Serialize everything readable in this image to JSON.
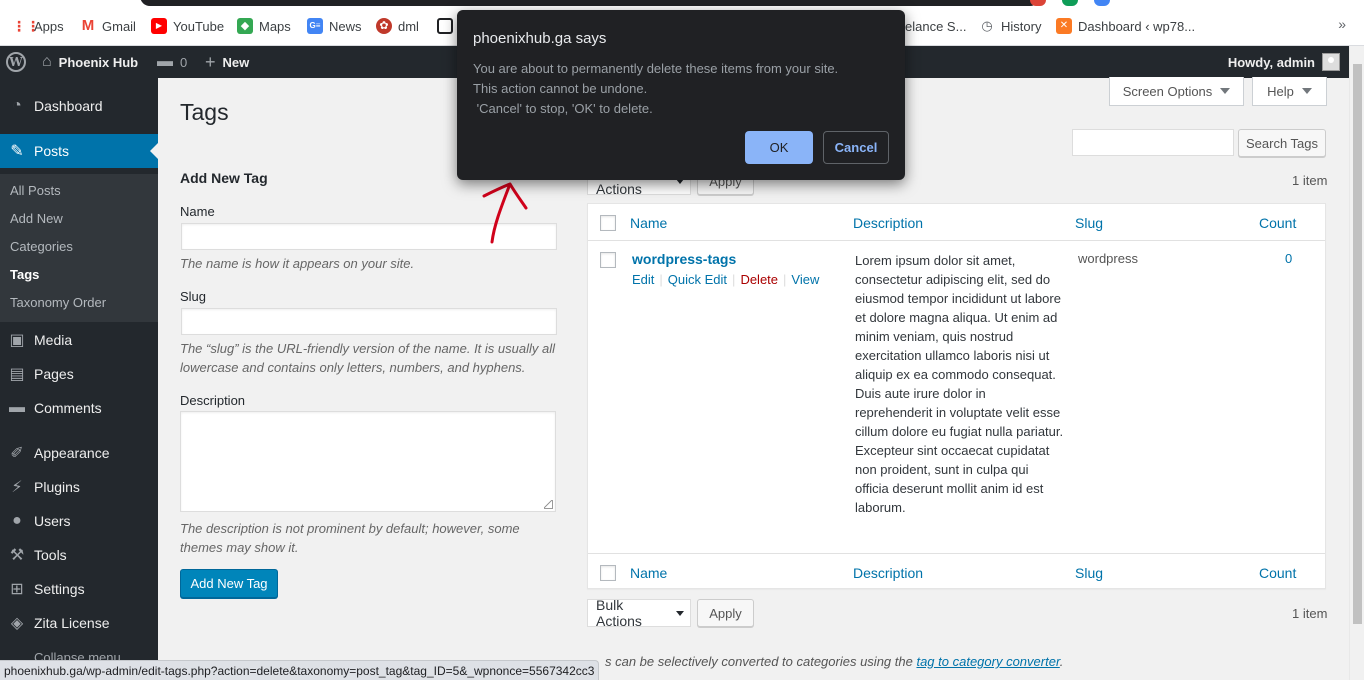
{
  "bookmarks": [
    {
      "label": "Apps",
      "icon": "apps-grid-icon"
    },
    {
      "label": "Gmail",
      "icon": "gmail-icon"
    },
    {
      "label": "YouTube",
      "icon": "youtube-icon"
    },
    {
      "label": "Maps",
      "icon": "maps-icon"
    },
    {
      "label": "News",
      "icon": "news-icon"
    },
    {
      "label": "dml",
      "icon": "dml-icon"
    },
    {
      "label": "elance S...",
      "icon": "bookmark-icon"
    },
    {
      "label": "History",
      "icon": "history-icon"
    },
    {
      "label": "Dashboard ‹ wp78...",
      "icon": "xampp-icon"
    }
  ],
  "adminbar": {
    "site_name": "Phoenix Hub",
    "comments_count": "0",
    "new_label": "New",
    "howdy": "Howdy, admin"
  },
  "sidebar": {
    "items": [
      {
        "label": "Dashboard",
        "icon": "dashboard-icon"
      },
      {
        "label": "Posts",
        "icon": "pin-icon",
        "active": true
      },
      {
        "label": "Media",
        "icon": "media-icon"
      },
      {
        "label": "Pages",
        "icon": "pages-icon"
      },
      {
        "label": "Comments",
        "icon": "comment-icon"
      },
      {
        "label": "Appearance",
        "icon": "brush-icon"
      },
      {
        "label": "Plugins",
        "icon": "plug-icon"
      },
      {
        "label": "Users",
        "icon": "user-icon"
      },
      {
        "label": "Tools",
        "icon": "wrench-icon"
      },
      {
        "label": "Settings",
        "icon": "settings-icon"
      },
      {
        "label": "Zita License",
        "icon": "zita-icon"
      }
    ],
    "submenu": [
      "All Posts",
      "Add New",
      "Categories",
      "Tags",
      "Taxonomy Order"
    ],
    "current_sub": "Tags",
    "collapse": "Collapse menu"
  },
  "page": {
    "title": "Tags",
    "screen_options": "Screen Options",
    "help": "Help"
  },
  "form": {
    "heading": "Add New Tag",
    "name_label": "Name",
    "name_hint": "The name is how it appears on your site.",
    "slug_label": "Slug",
    "slug_hint": "The “slug” is the URL-friendly version of the name. It is usually all lowercase and contains only letters, numbers, and hyphens.",
    "description_label": "Description",
    "description_hint": "The description is not prominent by default; however, some themes may show it.",
    "submit": "Add New Tag"
  },
  "list": {
    "search_button": "Search Tags",
    "bulk_actions": "Bulk Actions",
    "apply": "Apply",
    "items_count": "1 item",
    "columns": {
      "name": "Name",
      "description": "Description",
      "slug": "Slug",
      "count": "Count"
    },
    "rows": [
      {
        "name": "wordpress-tags",
        "actions": [
          "Edit",
          "Quick Edit",
          "Delete",
          "View"
        ],
        "description": "Lorem ipsum dolor sit amet, consectetur adipiscing elit, sed do eiusmod tempor incididunt ut labore et dolore magna aliqua. Ut enim ad minim veniam, quis nostrud exercitation ullamco laboris nisi ut aliquip ex ea commodo consequat. Duis aute irure dolor in reprehenderit in voluptate velit esse cillum dolore eu fugiat nulla pariatur. Excepteur sint occaecat cupidatat non proident, sunt in culpa qui officia deserunt mollit anim id est laborum.",
        "slug": "wordpress",
        "count": "0"
      }
    ],
    "footnote_prefix": "s can be selectively converted to categories using the ",
    "footnote_link": "tag to category converter",
    "footnote_suffix": "."
  },
  "status_url": "phoenixhub.ga/wp-admin/edit-tags.php?action=delete&taxonomy=post_tag&tag_ID=5&_wpnonce=5567342cc3",
  "dialog": {
    "title": "phoenixhub.ga says",
    "message": "You are about to permanently delete these items from your site.\nThis action cannot be undone.\n 'Cancel' to stop, 'OK' to delete.",
    "ok": "OK",
    "cancel": "Cancel"
  },
  "colors": {
    "admin_dark": "#23282d",
    "wp_blue": "#0073aa",
    "primary_button": "#0085ba",
    "delete_red": "#a00",
    "dialog_bg": "#202124",
    "dialog_accent": "#8ab4f8",
    "annotation_red": "#d0021b"
  }
}
